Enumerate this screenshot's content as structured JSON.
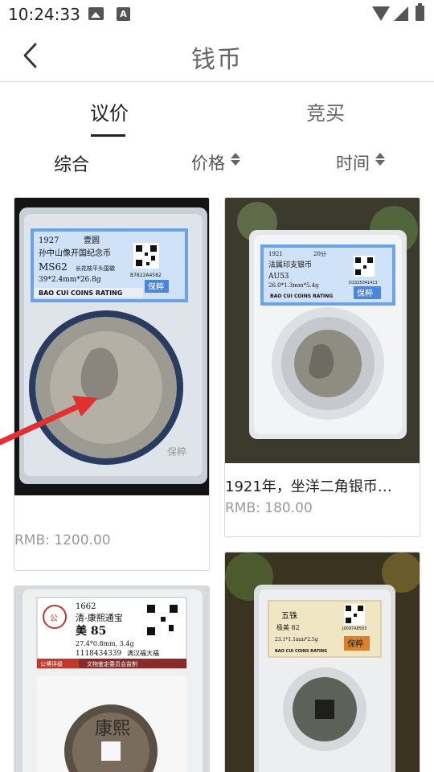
{
  "status_bar": {
    "time": "10:24:33"
  },
  "header": {
    "title": "钱币"
  },
  "tabs": [
    {
      "label": "议价",
      "active": true
    },
    {
      "label": "竞买",
      "active": false
    }
  ],
  "sort": {
    "all_label": "综合",
    "price_label": "价格",
    "time_label": "时间"
  },
  "cards": [
    {
      "title": "",
      "price": "RMB: 1200.00",
      "slab": {
        "year": "1927",
        "denom": "壹圆",
        "name": "孙中山像开国纪念币",
        "grade": "MS62",
        "spec": "39*2.4mm*26.8g",
        "variety": "长花枝平头国徽",
        "serial": "B7822A4582",
        "brand": "BAO CUI COINS RATING",
        "badge": "保粹"
      }
    },
    {
      "title": "1921年，坐洋二角银币…",
      "price": "RMB: 180.00",
      "slab": {
        "year": "1921",
        "denom": "20分",
        "name": "法属印支银币",
        "grade": "AU53",
        "spec": "26.0*1.3mm*5.4g",
        "serial": "D3325041413",
        "brand": "BAO CUI COINS RATING",
        "badge": "保粹"
      }
    },
    {
      "title": "",
      "price": "",
      "slab": {
        "year": "1662",
        "name": "清-康熙通宝",
        "grade": "美 85",
        "spec": "27.4*0.8mm, 3.4g",
        "serial": "1118434339",
        "note": "满汉福大福",
        "footer_left": "公博评级",
        "footer_right": "文物鉴定委员会监制",
        "coin_chars": "康熙"
      }
    },
    {
      "title": "",
      "price": "",
      "slab": {
        "name": "五铢",
        "grade": "极美 82",
        "spec": "23.1*1.1mm*2.5g",
        "serial": "J0097A8583",
        "brand": "BAO CUI COINS RATING",
        "badge": "保粹"
      }
    }
  ],
  "colors": {
    "accent_text": "#222222",
    "muted_text": "#999999",
    "divider": "#d8d8d8",
    "label_blue": "#5b8fd6",
    "badge_blue": "#4a86d9",
    "badge_orange": "#d9822b",
    "arrow_red": "#e03030"
  }
}
